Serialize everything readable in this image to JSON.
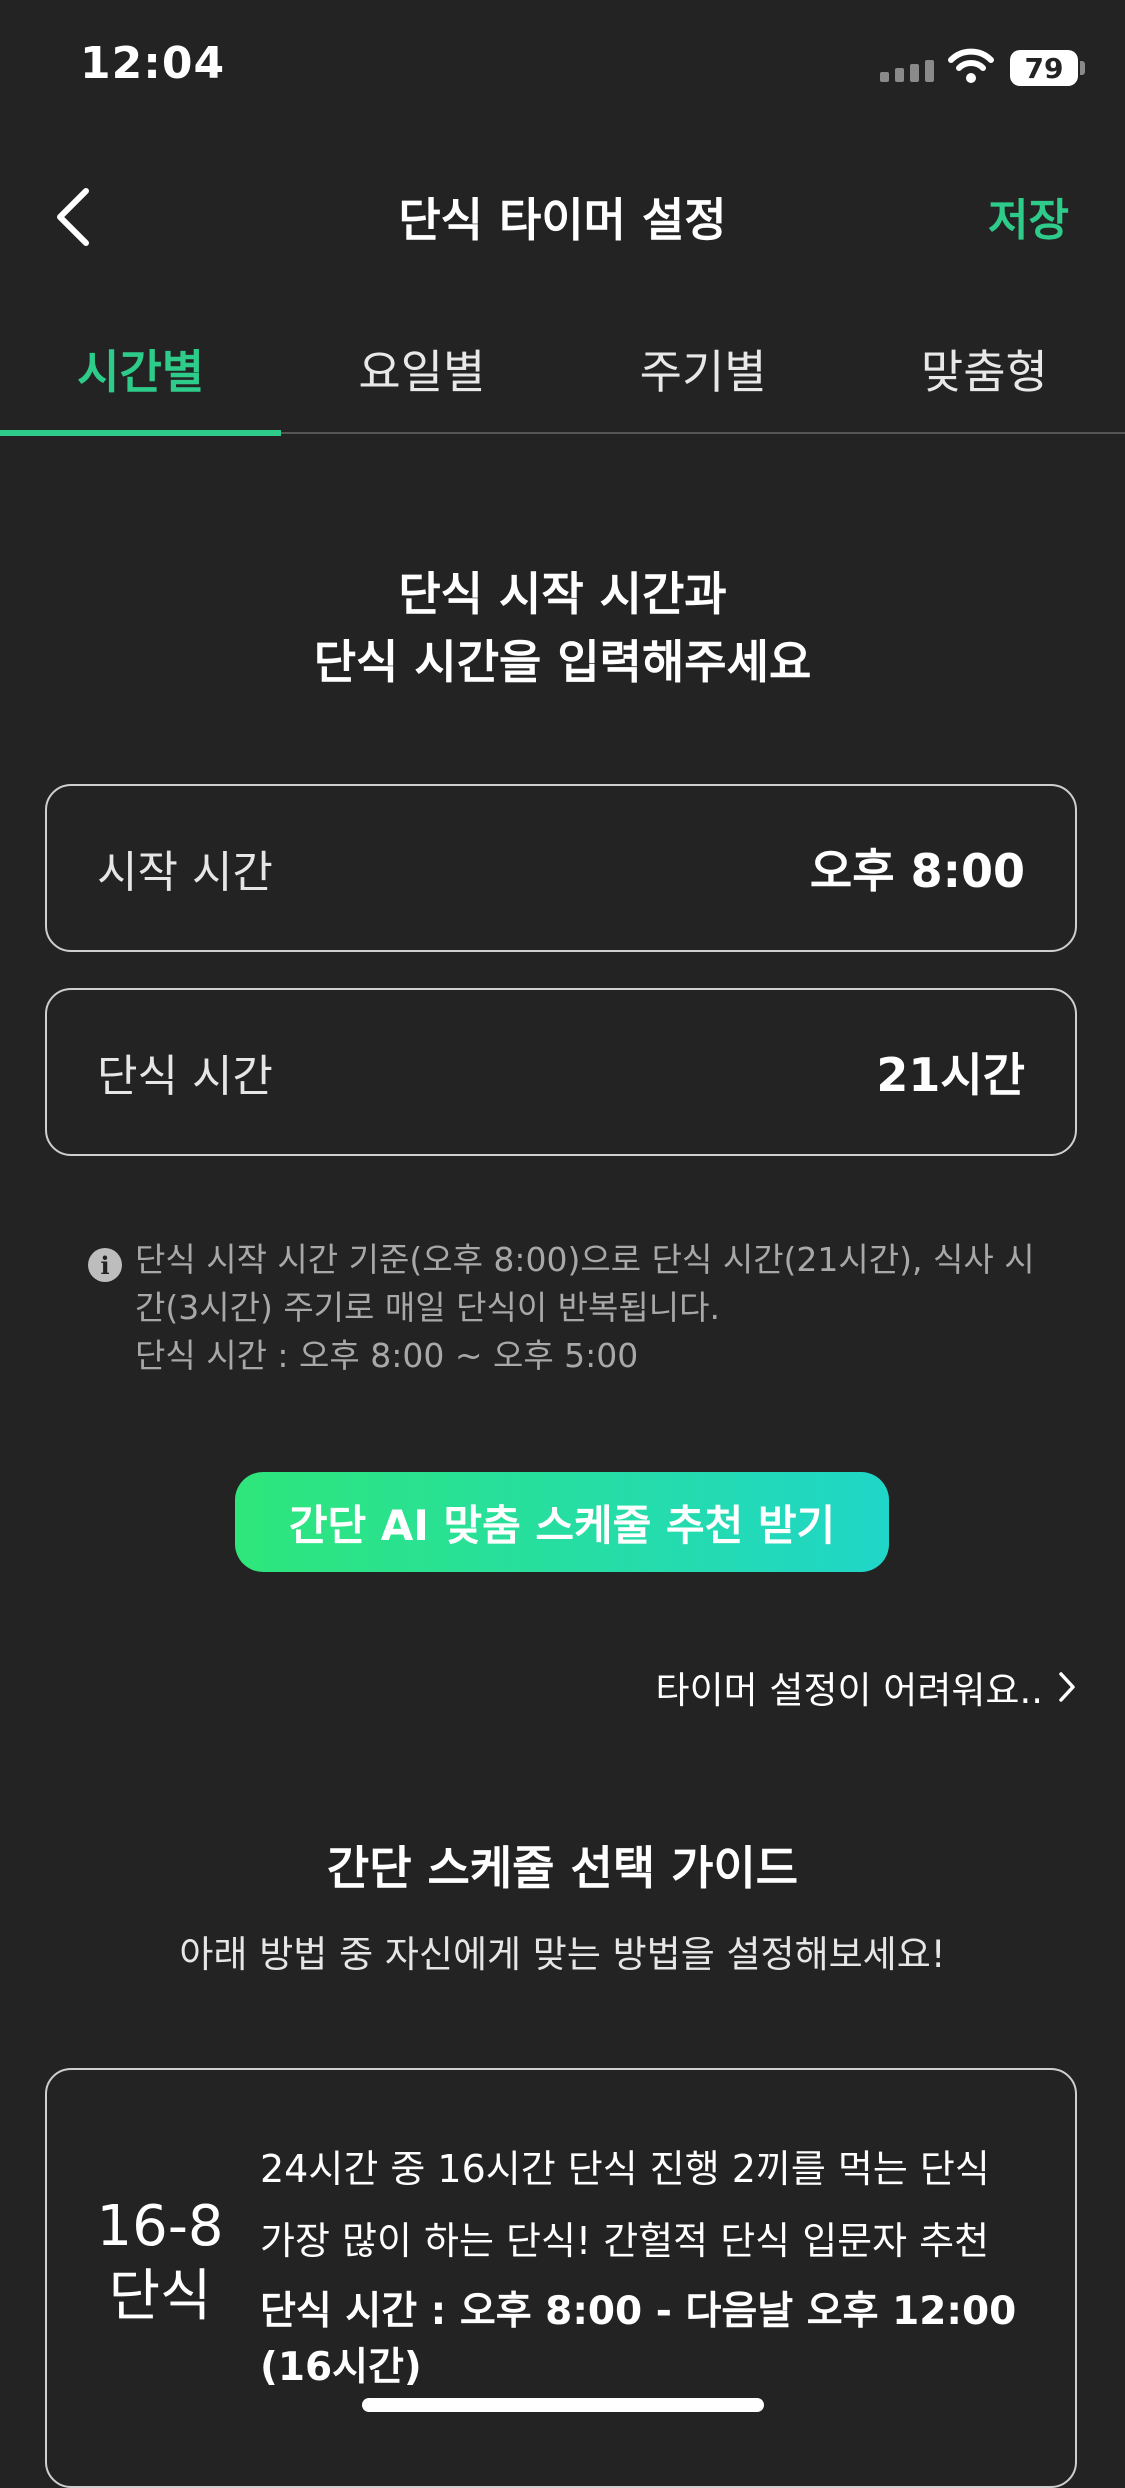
{
  "status_bar": {
    "time": "12:04",
    "battery": "79"
  },
  "header": {
    "title": "단식 타이머 설정",
    "save_label": "저장"
  },
  "tabs": [
    {
      "label": "시간별",
      "active": true
    },
    {
      "label": "요일별",
      "active": false
    },
    {
      "label": "주기별",
      "active": false
    },
    {
      "label": "맞춤형",
      "active": false
    }
  ],
  "heading": {
    "line1": "단식 시작 시간과",
    "line2": "단식 시간을 입력해주세요"
  },
  "fields": {
    "start_time": {
      "label": "시작 시간",
      "value": "오후 8:00"
    },
    "fast_duration": {
      "label": "단식 시간",
      "value": "21시간"
    }
  },
  "info": {
    "line1": "단식 시작 시간 기준(오후 8:00)으로 단식 시간(21시간), 식사 시",
    "line2": "간(3시간) 주기로 매일 단식이 반복됩니다.",
    "line3": "단식 시간 : 오후 8:00 ~ 오후 5:00"
  },
  "ai_button_label": "간단 AI 맞춤 스케줄 추천 받기",
  "help_link_label": "타이머 설정이 어려워요..",
  "guide": {
    "title": "간단 스케줄 선택 가이드",
    "subtitle": "아래 방법 중 자신에게 맞는 방법을 설정해보세요!",
    "cards": [
      {
        "label_line1": "16-8",
        "label_line2": "단식",
        "desc1": "24시간 중 16시간 단식 진행 2끼를 먹는 단식",
        "desc2": "가장 많이 하는 단식! 간헐적 단식 입문자 추천",
        "schedule": "단식 시간 : 오후 8:00 - 다음날 오후 12:00 (16시간)"
      }
    ]
  },
  "colors": {
    "accent": "#2ecc8a",
    "background": "#232323"
  }
}
